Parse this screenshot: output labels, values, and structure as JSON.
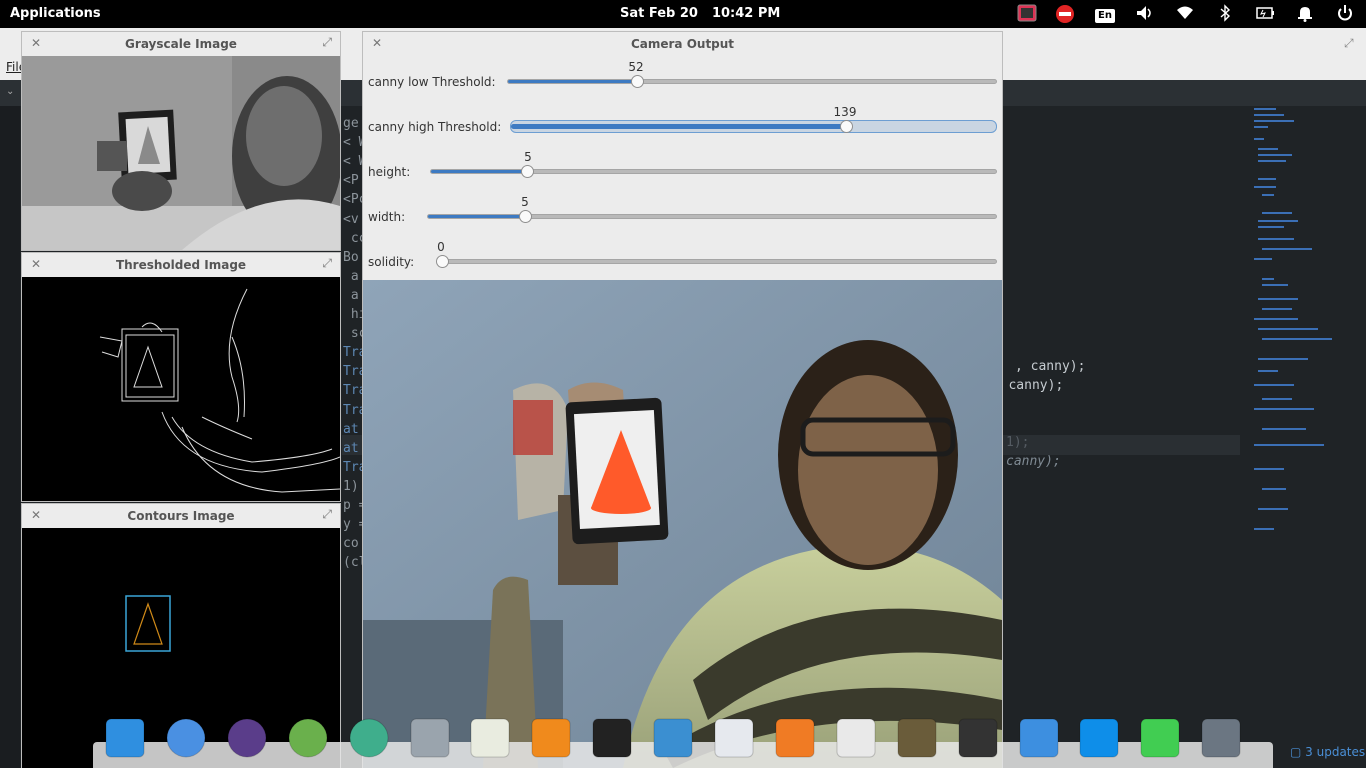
{
  "panel": {
    "apps_label": "Applications",
    "date": "Sat Feb 20",
    "time": "10:42 PM",
    "keyboard_layout": "En"
  },
  "editor": {
    "file_menu": "File",
    "line_fragments": [
      "ge",
      "< W",
      "< W",
      "<P",
      "<Pc",
      "<v",
      " cc",
      "Bo",
      " a",
      " a",
      " hi",
      " sc",
      "Tra",
      "Tra",
      "Tra",
      "Tra",
      "at",
      "at",
      "Tra",
      "1)",
      "p =",
      "y =",
      "co",
      "(cl"
    ],
    "right_code": [
      ", canny);",
      "l, canny);",
      "1);",
      "canny);"
    ]
  },
  "windows": {
    "grayscale": {
      "title": "Grayscale Image"
    },
    "thresholded": {
      "title": "Thresholded Image"
    },
    "contours": {
      "title": "Contours Image"
    },
    "camera": {
      "title": "Camera Output"
    }
  },
  "sliders": [
    {
      "label": "canny low Threshold:",
      "value": "52",
      "fraction": 0.265
    },
    {
      "label": "canny high Threshold:",
      "value": "139",
      "fraction": 0.69
    },
    {
      "label": "height:",
      "value": "5",
      "fraction": 0.17
    },
    {
      "label": "width:",
      "value": "5",
      "fraction": 0.17
    },
    {
      "label": "solidity:",
      "value": "0",
      "fraction": 0.0
    }
  ],
  "dock": {
    "items": [
      "workspaces-icon",
      "chromium-icon",
      "eclipse-icon",
      "android-studio-icon",
      "atom-icon",
      "files-icon",
      "calendar-icon",
      "music-icon",
      "terminal-icon",
      "photos-icon",
      "switchboard-icon",
      "app-center-icon",
      "text-editor-icon",
      "gimp-icon",
      "screenshot-icon",
      "dropbox-icon",
      "teamviewer-icon",
      "qt-creator-icon",
      "system-settings-icon"
    ],
    "updates": "3 updates"
  },
  "colors": {
    "accent": "#3d7ac2",
    "cone": "#ff5a2a",
    "contour_box": "#3aa6d8",
    "contour_cone": "#d08a18"
  }
}
